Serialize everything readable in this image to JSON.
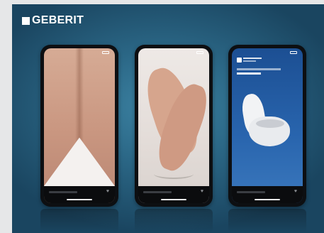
{
  "brand": {
    "name": "GEBERIT"
  },
  "phones": [
    {
      "id": "phone-1",
      "scene": "knees"
    },
    {
      "id": "phone-2",
      "scene": "clasped-hands"
    },
    {
      "id": "phone-3",
      "scene": "wall-hung-toilet"
    }
  ],
  "colors": {
    "background": "#2b6786",
    "logo": "#ffffff",
    "phone_frame": "#0d0f12",
    "story_blue": "#2864ad"
  }
}
